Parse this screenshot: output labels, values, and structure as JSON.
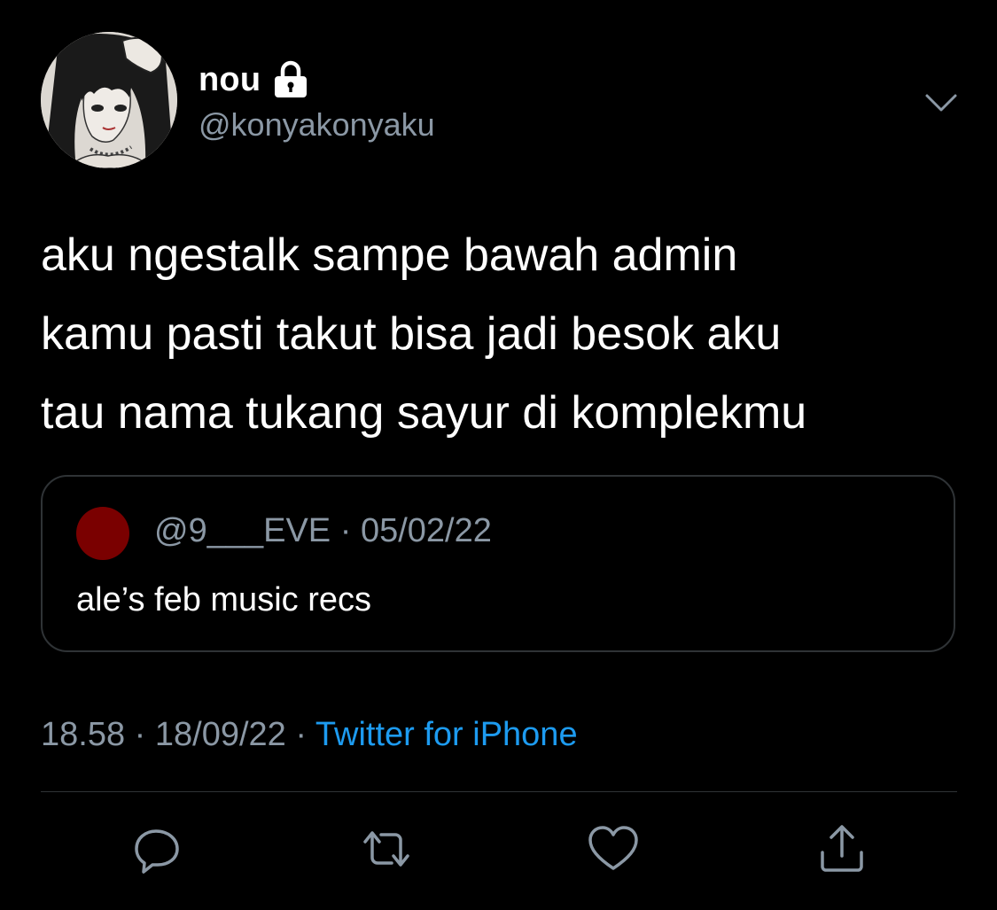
{
  "user": {
    "display_name": "nou",
    "handle": "@konyakonyaku",
    "protected_icon": "lock-icon",
    "avatar": "manga-portrait-avatar"
  },
  "tweet": {
    "text_lines": [
      "aku ngestalk sampe bawah admin",
      "kamu pasti takut bisa jadi besok aku",
      "tau nama tukang sayur di komplekmu"
    ]
  },
  "quote": {
    "handle": "@9___EVE",
    "separator": "·",
    "date": "05/02/22",
    "text": "ale’s feb music recs",
    "avatar_color": "#7a0000"
  },
  "meta": {
    "time": "18.58",
    "sep1": "·",
    "date": "18/09/22",
    "sep2": "·",
    "source": "Twitter for iPhone"
  },
  "actions": [
    {
      "name": "reply",
      "icon": "reply-icon"
    },
    {
      "name": "retweet",
      "icon": "retweet-icon"
    },
    {
      "name": "like",
      "icon": "heart-icon"
    },
    {
      "name": "share",
      "icon": "share-icon"
    }
  ],
  "colors": {
    "background": "#000000",
    "primary_text": "#ffffff",
    "secondary_text": "#8b98a5",
    "link": "#1d9bf0",
    "border": "#2f3336"
  }
}
